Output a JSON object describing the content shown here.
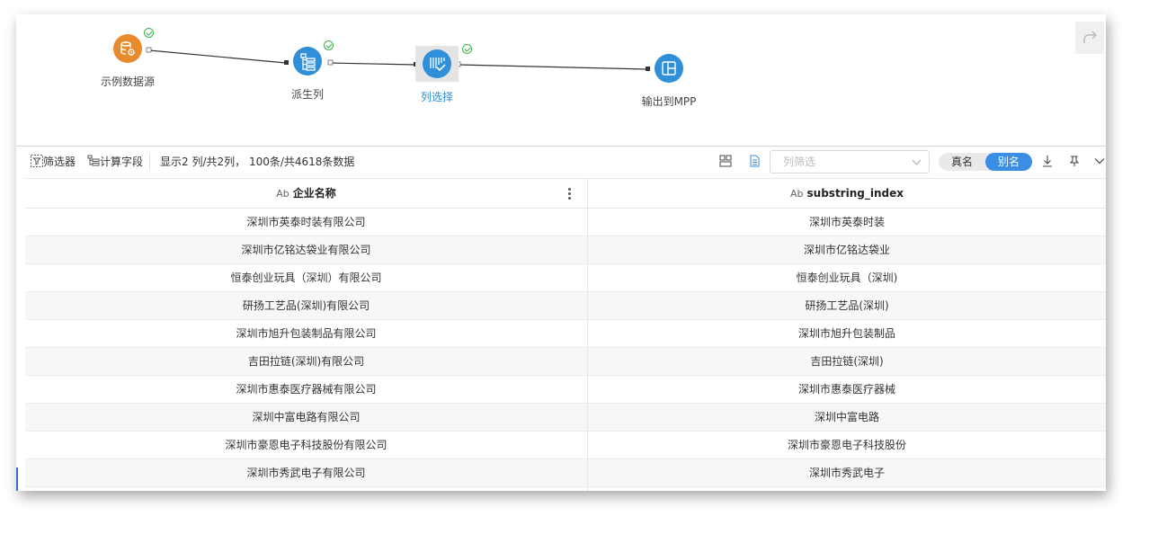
{
  "flow": {
    "nodes": [
      {
        "label": "示例数据源",
        "icon": "database-gear-icon",
        "color": "#e88b2e",
        "status": "ok"
      },
      {
        "label": "派生列",
        "icon": "derive-column-icon",
        "color": "#2f8fd8",
        "status": "ok"
      },
      {
        "label": "列选择",
        "icon": "column-select-icon",
        "color": "#2f8fd8",
        "status": "ok",
        "selected": true
      },
      {
        "label": "输出到MPP",
        "icon": "output-mpp-icon",
        "color": "#2f8fd8"
      }
    ],
    "redo_icon": "redo-icon"
  },
  "toolbar": {
    "filter_label": "筛选器",
    "calc_field_label": "计算字段",
    "summary": "显示2 列/共2列， 100条/共4618条数据",
    "column_filter_placeholder": "列筛选",
    "toggle_real": "真名",
    "toggle_alias": "别名",
    "toggle_selected": "别名"
  },
  "table": {
    "type_badge": "Ab",
    "columns": [
      "企业名称",
      "substring_index"
    ],
    "rows": [
      [
        "深圳市英泰时装有限公司",
        "深圳市英泰时装"
      ],
      [
        "深圳市亿铭达袋业有限公司",
        "深圳市亿铭达袋业"
      ],
      [
        "恒泰创业玩具（深圳）有限公司",
        "恒泰创业玩具（深圳)"
      ],
      [
        "研扬工艺品(深圳)有限公司",
        "研扬工艺品(深圳)"
      ],
      [
        "深圳市旭升包装制品有限公司",
        "深圳市旭升包装制品"
      ],
      [
        "吉田拉链(深圳)有限公司",
        "吉田拉链(深圳)"
      ],
      [
        "深圳市惠泰医疗器械有限公司",
        "深圳市惠泰医疗器械"
      ],
      [
        "深圳中富电路有限公司",
        "深圳中富电路"
      ],
      [
        "深圳市豪恩电子科技股份有限公司",
        "深圳市豪恩电子科技股份"
      ],
      [
        "深圳市秀武电子有限公司",
        "深圳市秀武电子"
      ]
    ]
  }
}
